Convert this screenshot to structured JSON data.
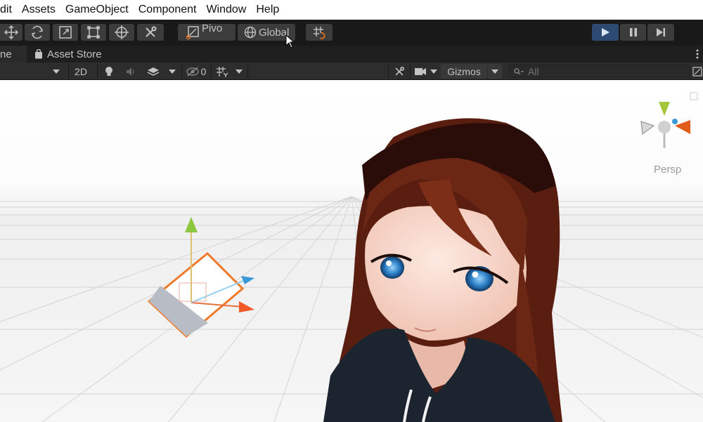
{
  "menu": {
    "items": [
      "dit",
      "Assets",
      "GameObject",
      "Component",
      "Window",
      "Help"
    ]
  },
  "toolbar": {
    "pivot_label": "Pivo",
    "global_label": "Global",
    "colors": {
      "play_active": "#2d4a72",
      "accent_icon": "#e07020"
    }
  },
  "tabs": {
    "scene_label": "ne",
    "asset_store_label": "Asset Store"
  },
  "scene_toolbar": {
    "mode_2d": "2D",
    "hidden_count": "0",
    "gizmos_label": "Gizmos",
    "search_placeholder": "All"
  },
  "viewport": {
    "projection_label": "Persp"
  }
}
